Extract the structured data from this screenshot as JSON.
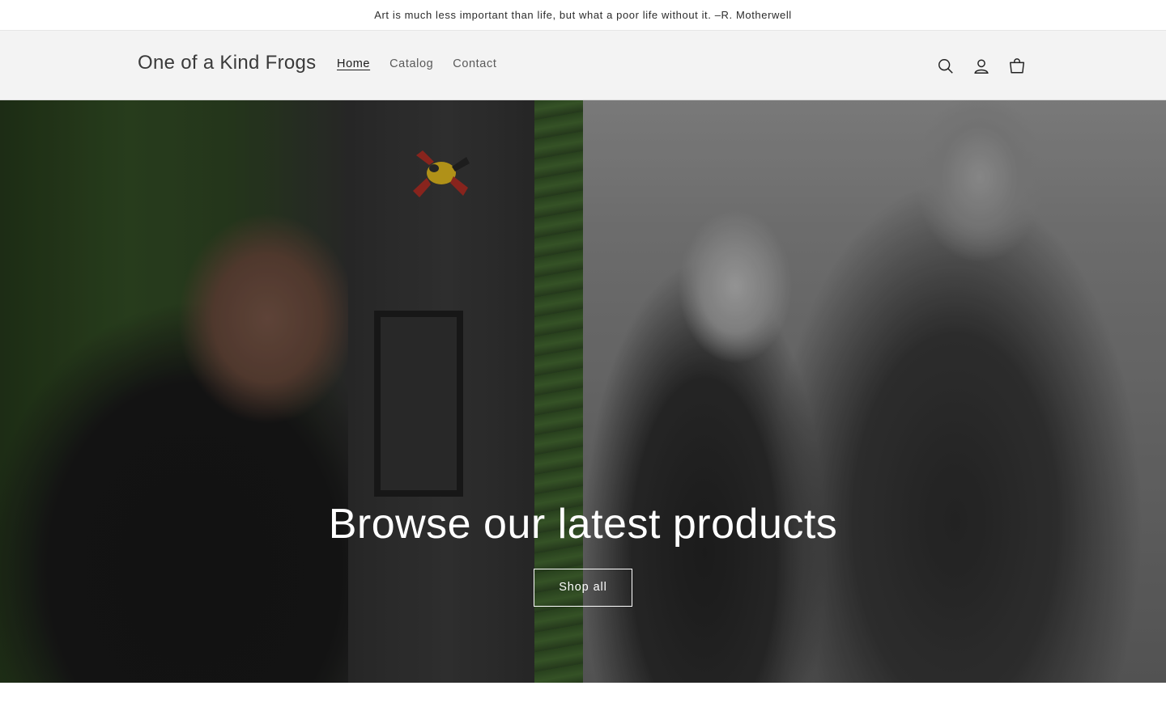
{
  "announcement": {
    "text": "Art is much less important than life, but what a poor life without it. –R. Motherwell"
  },
  "header": {
    "logo": "One of a Kind Frogs",
    "nav": [
      {
        "label": "Home",
        "active": true
      },
      {
        "label": "Catalog",
        "active": false
      },
      {
        "label": "Contact",
        "active": false
      }
    ],
    "icons": [
      "search-icon",
      "account-icon",
      "cart-icon"
    ]
  },
  "hero": {
    "heading": "Browse our latest products",
    "button_label": "Shop all"
  },
  "colors": {
    "header_bg": "#f3f3f3",
    "text": "#121212",
    "hero_text": "#ffffff"
  }
}
